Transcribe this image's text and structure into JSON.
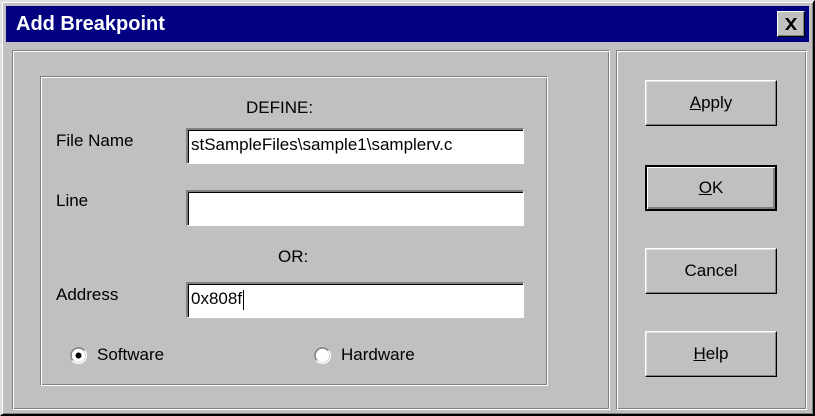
{
  "window": {
    "title": "Add Breakpoint",
    "title_bar_color": "#000080",
    "face_color": "#c0c0c0"
  },
  "titlebar_controls": {
    "close_icon": "close-x-icon"
  },
  "form": {
    "define_header": "DEFINE:",
    "or_header": "OR:",
    "file_name": {
      "label": "File Name",
      "value": "stSampleFiles\\sample1\\samplerv.c"
    },
    "line": {
      "label": "Line",
      "value": ""
    },
    "address": {
      "label": "Address",
      "value": "0x808f"
    },
    "breakpoint_type": {
      "options": [
        "Software",
        "Hardware"
      ],
      "selected": "Software"
    }
  },
  "buttons": {
    "apply": {
      "mnemonic": "A",
      "rest": "pply"
    },
    "ok": {
      "mnemonic": "O",
      "rest": "K",
      "is_default": true
    },
    "cancel": {
      "label": "Cancel"
    },
    "help": {
      "mnemonic": "H",
      "rest": "elp"
    }
  }
}
